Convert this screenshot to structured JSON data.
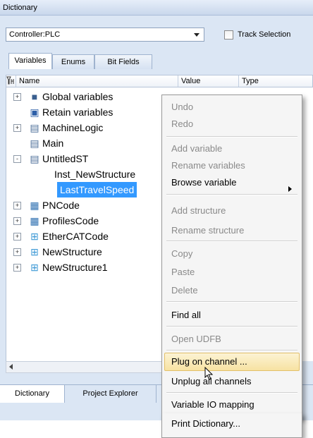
{
  "window": {
    "title": "Dictionary"
  },
  "controller_select": {
    "value": "Controller:PLC"
  },
  "track_selection": {
    "label": "Track Selection",
    "checked": false
  },
  "tabs": [
    {
      "label": "Variables",
      "active": true
    },
    {
      "label": "Enums",
      "active": false
    },
    {
      "label": "Bit Fields",
      "active": false
    }
  ],
  "columns": {
    "name": "Name",
    "value": "Value",
    "type": "Type"
  },
  "tree": [
    {
      "label": "Global variables",
      "icon": "global-variables-icon",
      "expander": "+"
    },
    {
      "label": "Retain variables",
      "icon": "retain-variables-icon",
      "expander": ""
    },
    {
      "label": "MachineLogic",
      "icon": "program-icon",
      "expander": "+"
    },
    {
      "label": "Main",
      "icon": "program-icon",
      "expander": ""
    },
    {
      "label": "UntitledST",
      "icon": "program-icon",
      "expander": "-"
    },
    {
      "label": "Inst_NewStructure",
      "icon": "",
      "expander": ""
    },
    {
      "label": "LastTravelSpeed",
      "icon": "",
      "expander": "",
      "selected": true
    },
    {
      "label": "PNCode",
      "icon": "code-module-icon",
      "expander": "+"
    },
    {
      "label": "ProfilesCode",
      "icon": "code-module-icon",
      "expander": "+"
    },
    {
      "label": "EtherCATCode",
      "icon": "structure-icon",
      "expander": "+"
    },
    {
      "label": "NewStructure",
      "icon": "structure-icon",
      "expander": "+"
    },
    {
      "label": "NewStructure1",
      "icon": "structure-icon",
      "expander": "+"
    }
  ],
  "context_menu": {
    "items": [
      {
        "label": "Undo",
        "enabled": false
      },
      {
        "label": "Redo",
        "enabled": false
      },
      {
        "label": "Add variable",
        "enabled": false
      },
      {
        "label": "Rename variables",
        "enabled": false
      },
      {
        "label": "Browse variable",
        "enabled": true,
        "submenu": true
      },
      {
        "label": "Add structure",
        "enabled": false
      },
      {
        "label": "Rename structure",
        "enabled": false
      },
      {
        "label": "Copy",
        "enabled": false
      },
      {
        "label": "Paste",
        "enabled": false
      },
      {
        "label": "Delete",
        "enabled": false
      },
      {
        "label": "Find all",
        "enabled": true
      },
      {
        "label": "Open UDFB",
        "enabled": false
      },
      {
        "label": "Plug on channel ...",
        "enabled": true,
        "highlighted": true
      },
      {
        "label": "Unplug all channels",
        "enabled": true
      },
      {
        "label": "Variable IO mapping",
        "enabled": true
      },
      {
        "label": "Print Dictionary...",
        "enabled": true
      }
    ]
  },
  "bottom_tabs": [
    {
      "label": "Dictionary",
      "active": true
    },
    {
      "label": "Project Explorer",
      "active": false
    }
  ],
  "colors": {
    "selection": "#3399ff",
    "menu_highlight": "#f7e2a2",
    "panel_background": "#dbe6f4"
  }
}
